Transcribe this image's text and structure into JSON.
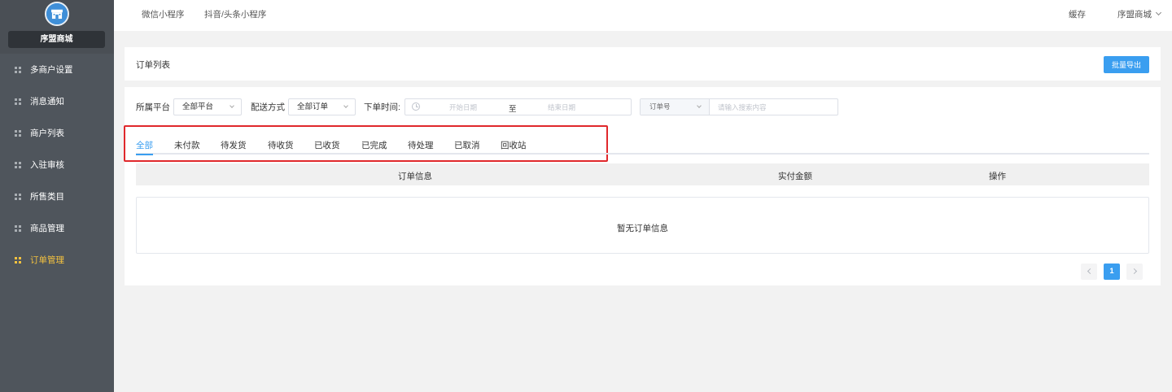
{
  "sidebar": {
    "brand": "序盟商城",
    "items": [
      {
        "label": "多商户设置",
        "active": false
      },
      {
        "label": "消息通知",
        "active": false
      },
      {
        "label": "商户列表",
        "active": false
      },
      {
        "label": "入驻审核",
        "active": false
      },
      {
        "label": "所售类目",
        "active": false
      },
      {
        "label": "商品管理",
        "active": false
      },
      {
        "label": "订单管理",
        "active": true
      }
    ]
  },
  "topbar": {
    "tabs": [
      "微信小程序",
      "抖音/头条小程序"
    ],
    "cache": "缓存",
    "user": "序盟商城"
  },
  "header": {
    "title": "订单列表",
    "export_label": "批量导出"
  },
  "filters": {
    "platform_label": "所属平台",
    "platform_value": "全部平台",
    "delivery_label": "配送方式",
    "delivery_value": "全部订单",
    "time_label": "下单时间:",
    "start_placeholder": "开始日期",
    "range_separator": "至",
    "end_placeholder": "结束日期",
    "search_type": "订单号",
    "search_placeholder": "请输入搜索内容"
  },
  "status_tabs": [
    "全部",
    "未付款",
    "待发货",
    "待收货",
    "已收货",
    "已完成",
    "待处理",
    "已取消",
    "回收站"
  ],
  "table": {
    "columns": [
      "订单信息",
      "实付金额",
      "操作"
    ],
    "empty_text": "暂无订单信息"
  },
  "pagination": {
    "current_page": "1"
  },
  "colors": {
    "accent": "#3a9ef0",
    "active_menu": "#f4c23f",
    "highlight": "#e0282c",
    "sidebar": "#4f555c"
  }
}
